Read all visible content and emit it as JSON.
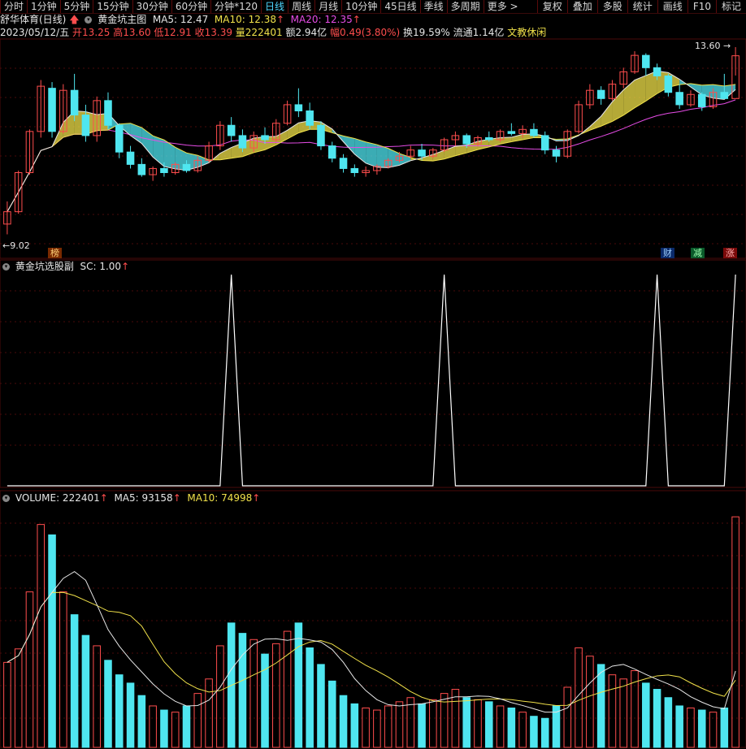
{
  "stock_name": "舒华体育(日线)",
  "timeframes": [
    "分时",
    "1分钟",
    "5分钟",
    "15分钟",
    "30分钟",
    "60分钟",
    "分钟*120",
    "日线",
    "周线",
    "月线",
    "10分钟",
    "45日线",
    "季线",
    "多周期",
    "更多 >"
  ],
  "active_timeframe": "日线",
  "tools": [
    "复权",
    "叠加",
    "多股",
    "统计",
    "画线",
    "F10",
    "标记"
  ],
  "main_indicator": {
    "name": "黄金坑主图",
    "ma5_label": "MA5: 12.47",
    "ma10_label": "MA10: 12.38",
    "ma20_label": "MA20: 12.35"
  },
  "quote": {
    "date": "2023/05/12/五",
    "open": "开13.25",
    "high": "高13.60",
    "low": "低12.91",
    "close": "收13.39",
    "volume": "量222401",
    "amount": "额2.94亿",
    "change": "幅0.49(3.80%)",
    "turnover": "换19.59%",
    "float": "流通1.14亿",
    "sector": "文教休闲"
  },
  "price_marks": {
    "high": "13.60",
    "low": "9.02"
  },
  "badges": {
    "bang": "榜",
    "cai": "财",
    "jian": "减",
    "zhang": "涨"
  },
  "sub_indicator": {
    "name": "黄金坑选股副",
    "value": "SC: 1.00"
  },
  "volume_indicator": {
    "volume": "VOLUME: 222401",
    "ma5": "MA5: 93158",
    "ma10": "MA10: 74998"
  },
  "colors": {
    "up": "#ff4d4d",
    "down": "#4fe6f0",
    "ma5": "#e6e6e6",
    "ma10": "#f0e14a",
    "ma20": "#e64ce6",
    "grid": "#4a0a0a"
  },
  "chart_data": {
    "type": "candlestick",
    "ylim": [
      9.02,
      13.6
    ],
    "candles": [
      [
        9.3,
        9.85,
        9.05,
        9.6
      ],
      [
        9.6,
        10.6,
        9.55,
        10.55
      ],
      [
        10.55,
        11.6,
        10.5,
        11.55
      ],
      [
        11.55,
        12.8,
        11.4,
        12.65
      ],
      [
        12.6,
        12.75,
        11.4,
        11.55
      ],
      [
        11.55,
        12.7,
        11.5,
        12.55
      ],
      [
        12.55,
        12.95,
        11.8,
        11.95
      ],
      [
        11.95,
        12.2,
        11.3,
        11.45
      ],
      [
        11.45,
        12.4,
        11.3,
        12.3
      ],
      [
        12.3,
        12.5,
        11.6,
        11.7
      ],
      [
        11.7,
        11.75,
        10.9,
        11.05
      ],
      [
        11.05,
        11.2,
        10.65,
        10.75
      ],
      [
        10.75,
        10.9,
        10.45,
        10.5
      ],
      [
        10.5,
        10.7,
        10.35,
        10.65
      ],
      [
        10.65,
        10.8,
        10.45,
        10.55
      ],
      [
        10.55,
        10.8,
        10.5,
        10.75
      ],
      [
        10.75,
        10.85,
        10.55,
        10.6
      ],
      [
        10.6,
        10.95,
        10.55,
        10.85
      ],
      [
        10.85,
        11.3,
        10.8,
        11.2
      ],
      [
        11.2,
        11.8,
        11.1,
        11.7
      ],
      [
        11.7,
        11.9,
        11.3,
        11.45
      ],
      [
        11.45,
        11.6,
        11.05,
        11.15
      ],
      [
        11.15,
        11.55,
        11.05,
        11.45
      ],
      [
        11.45,
        11.65,
        11.25,
        11.35
      ],
      [
        11.35,
        11.85,
        11.3,
        11.75
      ],
      [
        11.75,
        12.3,
        11.7,
        12.2
      ],
      [
        12.2,
        12.6,
        11.9,
        12.05
      ],
      [
        12.05,
        12.25,
        11.6,
        11.7
      ],
      [
        11.7,
        11.8,
        11.1,
        11.2
      ],
      [
        11.2,
        11.3,
        10.8,
        10.9
      ],
      [
        10.9,
        11.0,
        10.55,
        10.65
      ],
      [
        10.65,
        10.75,
        10.45,
        10.55
      ],
      [
        10.55,
        10.7,
        10.45,
        10.6
      ],
      [
        10.6,
        10.75,
        10.5,
        10.7
      ],
      [
        10.7,
        10.9,
        10.65,
        10.85
      ],
      [
        10.85,
        11.05,
        10.8,
        10.95
      ],
      [
        10.95,
        11.2,
        10.9,
        11.1
      ],
      [
        11.1,
        11.25,
        10.85,
        10.95
      ],
      [
        10.95,
        11.15,
        10.9,
        11.1
      ],
      [
        11.1,
        11.4,
        11.05,
        11.35
      ],
      [
        11.35,
        11.55,
        11.2,
        11.45
      ],
      [
        11.45,
        11.5,
        11.15,
        11.25
      ],
      [
        11.25,
        11.45,
        11.2,
        11.4
      ],
      [
        11.4,
        11.55,
        11.3,
        11.35
      ],
      [
        11.35,
        11.6,
        11.3,
        11.55
      ],
      [
        11.55,
        11.75,
        11.45,
        11.5
      ],
      [
        11.5,
        11.7,
        11.4,
        11.6
      ],
      [
        11.6,
        11.75,
        11.4,
        11.45
      ],
      [
        11.45,
        11.55,
        11.0,
        11.1
      ],
      [
        11.1,
        11.2,
        10.8,
        10.95
      ],
      [
        10.95,
        11.6,
        10.9,
        11.55
      ],
      [
        11.55,
        12.3,
        11.5,
        12.2
      ],
      [
        12.2,
        12.7,
        12.1,
        12.55
      ],
      [
        12.55,
        12.65,
        12.2,
        12.35
      ],
      [
        12.35,
        12.8,
        12.3,
        12.7
      ],
      [
        12.7,
        13.1,
        12.6,
        13.0
      ],
      [
        13.0,
        13.5,
        12.95,
        13.4
      ],
      [
        13.4,
        13.45,
        12.9,
        13.1
      ],
      [
        13.1,
        13.2,
        12.8,
        12.9
      ],
      [
        12.9,
        12.95,
        12.4,
        12.5
      ],
      [
        12.5,
        12.7,
        12.1,
        12.2
      ],
      [
        12.2,
        12.55,
        12.15,
        12.45
      ],
      [
        12.45,
        12.5,
        12.05,
        12.15
      ],
      [
        12.15,
        12.6,
        12.1,
        12.5
      ],
      [
        12.5,
        12.95,
        12.45,
        12.35
      ],
      [
        12.35,
        13.6,
        12.91,
        13.39
      ]
    ],
    "sc_signals": [
      20,
      39,
      58,
      65
    ],
    "volume": [
      82000,
      95000,
      150000,
      215000,
      205000,
      150000,
      128000,
      108000,
      98000,
      84000,
      70000,
      62000,
      50000,
      40000,
      36000,
      34000,
      40000,
      52000,
      66000,
      98000,
      120000,
      110000,
      104000,
      90000,
      100000,
      112000,
      120000,
      96000,
      80000,
      64000,
      50000,
      42000,
      38000,
      36000,
      40000,
      44000,
      48000,
      42000,
      46000,
      52000,
      56000,
      48000,
      46000,
      44000,
      40000,
      38000,
      34000,
      30000,
      28000,
      40000,
      58000,
      96000,
      88000,
      80000,
      70000,
      66000,
      74000,
      62000,
      56000,
      48000,
      40000,
      38000,
      36000,
      34000,
      38000,
      222401
    ]
  }
}
